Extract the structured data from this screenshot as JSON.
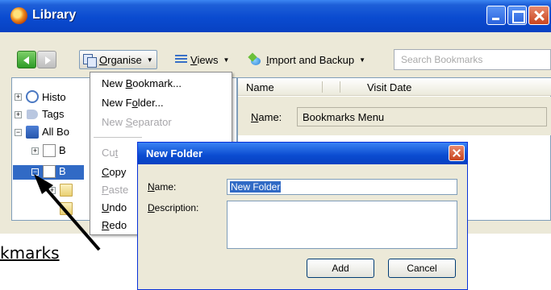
{
  "window": {
    "title": "Library"
  },
  "toolbar": {
    "organise_pre": "",
    "organise_key": "O",
    "organise_post": "rganise",
    "views_key": "V",
    "views_post": "iews",
    "import_key": "I",
    "import_post": "mport and Backup",
    "search_placeholder": "Search Bookmarks"
  },
  "tree": {
    "items": [
      {
        "label": "Histo"
      },
      {
        "label": "Tags"
      },
      {
        "label": "All Bo"
      },
      {
        "label": "B"
      },
      {
        "label": "B"
      }
    ]
  },
  "columns": {
    "name": "Name",
    "visit_date": "Visit Date"
  },
  "details": {
    "name_label_key": "N",
    "name_label_rest": "ame:",
    "name_value": "Bookmarks Menu"
  },
  "menu": {
    "items": [
      {
        "pre": "New ",
        "key": "B",
        "post": "ookmark...",
        "enabled": true
      },
      {
        "pre": "New F",
        "key": "o",
        "post": "lder...",
        "enabled": true
      },
      {
        "pre": "New ",
        "key": "S",
        "post": "eparator",
        "enabled": false
      },
      {
        "pre": "Cu",
        "key": "t",
        "post": "",
        "enabled": false
      },
      {
        "pre": "",
        "key": "C",
        "post": "opy",
        "enabled": true
      },
      {
        "pre": "",
        "key": "P",
        "post": "aste",
        "enabled": false
      },
      {
        "pre": "",
        "key": "U",
        "post": "ndo",
        "enabled": true
      },
      {
        "pre": "",
        "key": "R",
        "post": "edo",
        "enabled": true
      }
    ]
  },
  "dialog": {
    "title": "New Folder",
    "name_label_key": "N",
    "name_label_rest": "ame:",
    "name_value": "New Folder",
    "description_label_key": "D",
    "description_label_rest": "escription:",
    "add_label": "Add",
    "cancel_label": "Cancel"
  },
  "annotation": {
    "text": "kmarks"
  }
}
